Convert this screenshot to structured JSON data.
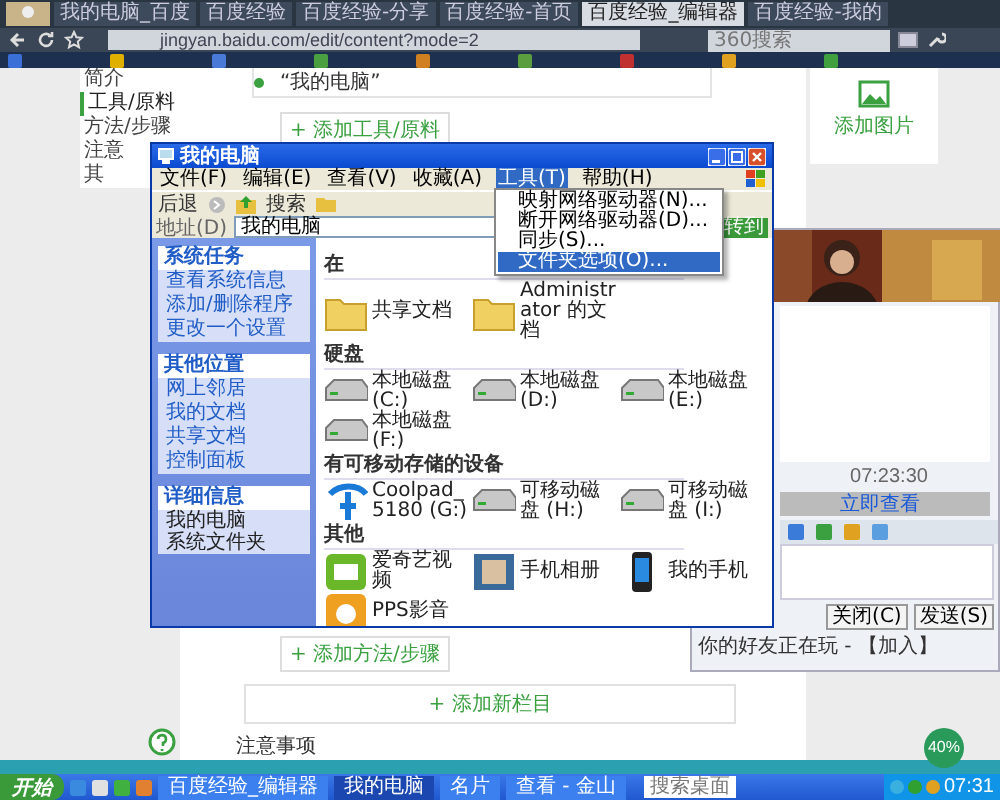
{
  "browser": {
    "tabs": [
      {
        "title": "我的电脑_百度",
        "selected": false
      },
      {
        "title": "百度经验",
        "selected": false
      },
      {
        "title": "百度经验-分享",
        "selected": false
      },
      {
        "title": "百度经验-首页",
        "selected": false
      },
      {
        "title": "百度经验_编辑器",
        "selected": true
      },
      {
        "title": "百度经验-我的",
        "selected": false
      }
    ],
    "address": "jingyan.baidu.com/edit/content?mode=2",
    "search": {
      "placeholder": "360搜索"
    }
  },
  "page": {
    "nav": [
      {
        "label": "简介",
        "selected": false
      },
      {
        "label": "工具/原料",
        "selected": true
      },
      {
        "label": "方法/步骤",
        "selected": false
      },
      {
        "label": "注意",
        "selected": false
      },
      {
        "label": "其",
        "selected": false
      }
    ],
    "step_text": "“我的电脑”",
    "add_tool_button": "+ 添加工具/原料",
    "add_step_button": "+ 添加方法/步骤",
    "add_section_button": "+ 添加新栏目",
    "section_heading": "注意事项",
    "side_label": "添加图片"
  },
  "explorer": {
    "title": "我的电脑",
    "menu": [
      {
        "label": "文件(F)",
        "open": false
      },
      {
        "label": "编辑(E)",
        "open": false
      },
      {
        "label": "查看(V)",
        "open": false
      },
      {
        "label": "收藏(A)",
        "open": false
      },
      {
        "label": "工具(T)",
        "open": true
      },
      {
        "label": "帮助(H)",
        "open": false
      }
    ],
    "dropdown": [
      {
        "label": "映射网络驱动器(N)...",
        "selected": false
      },
      {
        "label": "断开网络驱动器(D)...",
        "selected": false
      },
      {
        "label": "同步(S)...",
        "selected": false
      },
      {
        "label": "文件夹选项(O)...",
        "selected": true
      }
    ],
    "toolbar": {
      "back": "后退",
      "search": "搜索"
    },
    "address_label": "地址(D)",
    "address": "我的电脑",
    "go": "转到",
    "panels": [
      {
        "title": "系统任务",
        "items": [
          "查看系统信息",
          "添加/删除程序",
          "更改一个设置"
        ]
      },
      {
        "title": "其他位置",
        "items": [
          "网上邻居",
          "我的文档",
          "共享文档",
          "控制面板"
        ]
      },
      {
        "title": "详细信息",
        "items": [
          "我的电脑",
          "系统文件夹"
        ]
      }
    ],
    "groups": [
      {
        "heading": "在",
        "items": [
          {
            "label": "共享文档",
            "kind": "folder"
          },
          {
            "label": "Administrator 的文档",
            "kind": "folder"
          }
        ]
      },
      {
        "heading": "硬盘",
        "items": [
          {
            "label": "本地磁盘 (C:)",
            "kind": "drive"
          },
          {
            "label": "本地磁盘 (D:)",
            "kind": "drive"
          },
          {
            "label": "本地磁盘 (E:)",
            "kind": "drive"
          },
          {
            "label": "本地磁盘 (F:)",
            "kind": "drive"
          }
        ]
      },
      {
        "heading": "有可移动存储的设备",
        "items": [
          {
            "label": "Coolpad_5180 (G:)",
            "kind": "phone-drive"
          },
          {
            "label": "可移动磁盘 (H:)",
            "kind": "drive"
          },
          {
            "label": "可移动磁盘 (I:)",
            "kind": "drive"
          }
        ]
      },
      {
        "heading": "其他",
        "items": [
          {
            "label": "爱奇艺视频",
            "kind": "video"
          },
          {
            "label": "手机相册",
            "kind": "album"
          },
          {
            "label": "我的手机",
            "kind": "phone"
          },
          {
            "label": "PPS影音",
            "kind": "player"
          }
        ]
      }
    ]
  },
  "chat": {
    "time": "07:23:30",
    "link": "立即查看",
    "buttons": [
      "关闭(C)",
      "发送(S)"
    ],
    "notice": "你的好友正在玩 - 【加入】"
  },
  "taskbar": {
    "start": "开始",
    "tasks": [
      {
        "label": "百度经验_编辑器",
        "selected": false
      },
      {
        "label": "我的电脑",
        "selected": true
      },
      {
        "label": "名片",
        "selected": false
      },
      {
        "label": "查看 - 金山",
        "selected": false
      }
    ],
    "search": {
      "placeholder": "搜索桌面"
    },
    "clock": "07:31",
    "meter": "40%"
  }
}
